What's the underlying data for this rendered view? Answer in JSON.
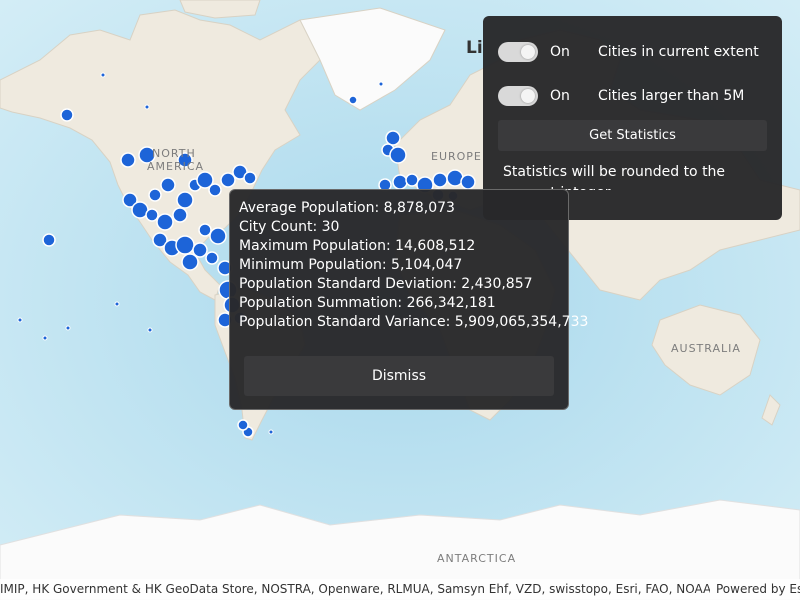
{
  "map": {
    "labels": {
      "north_america_1": "NORTH",
      "north_america_2": "AMERICA",
      "europe": "EUROPE",
      "australia": "AUSTRALIA",
      "antarctica": "ANTARCTICA",
      "partial_top": "Li"
    },
    "colors": {
      "ocean": "#c7e6f1",
      "land": "#efeadf",
      "ice": "#fbfbfb",
      "city": "#1d64d8"
    }
  },
  "settings": {
    "toggle1_state": "On",
    "toggle1_label": "Cities in current extent",
    "toggle2_state": "On",
    "toggle2_label": "Cities larger than 5M",
    "button_label": "Get Statistics",
    "note": "Statistics will be rounded to the nearest integer."
  },
  "popup": {
    "lines": [
      "Average Population: 8,878,073",
      "City Count: 30",
      "Maximum Population: 14,608,512",
      "Minimum Population: 5,104,047",
      "Population Standard Deviation: 2,430,857",
      "Population Summation: 266,342,181",
      "Population Standard Variance: 5,909,065,354,733"
    ],
    "dismiss_label": "Dismiss"
  },
  "attribution": {
    "sources": "IMIP, HK Government & HK GeoData Store, NOSTRA, Openware, RLMUA, Samsyn Ehf, VZD, swisstopo, Esri, FAO, NOAA, USGS, NRCan",
    "powered": "Powered by Esri"
  }
}
